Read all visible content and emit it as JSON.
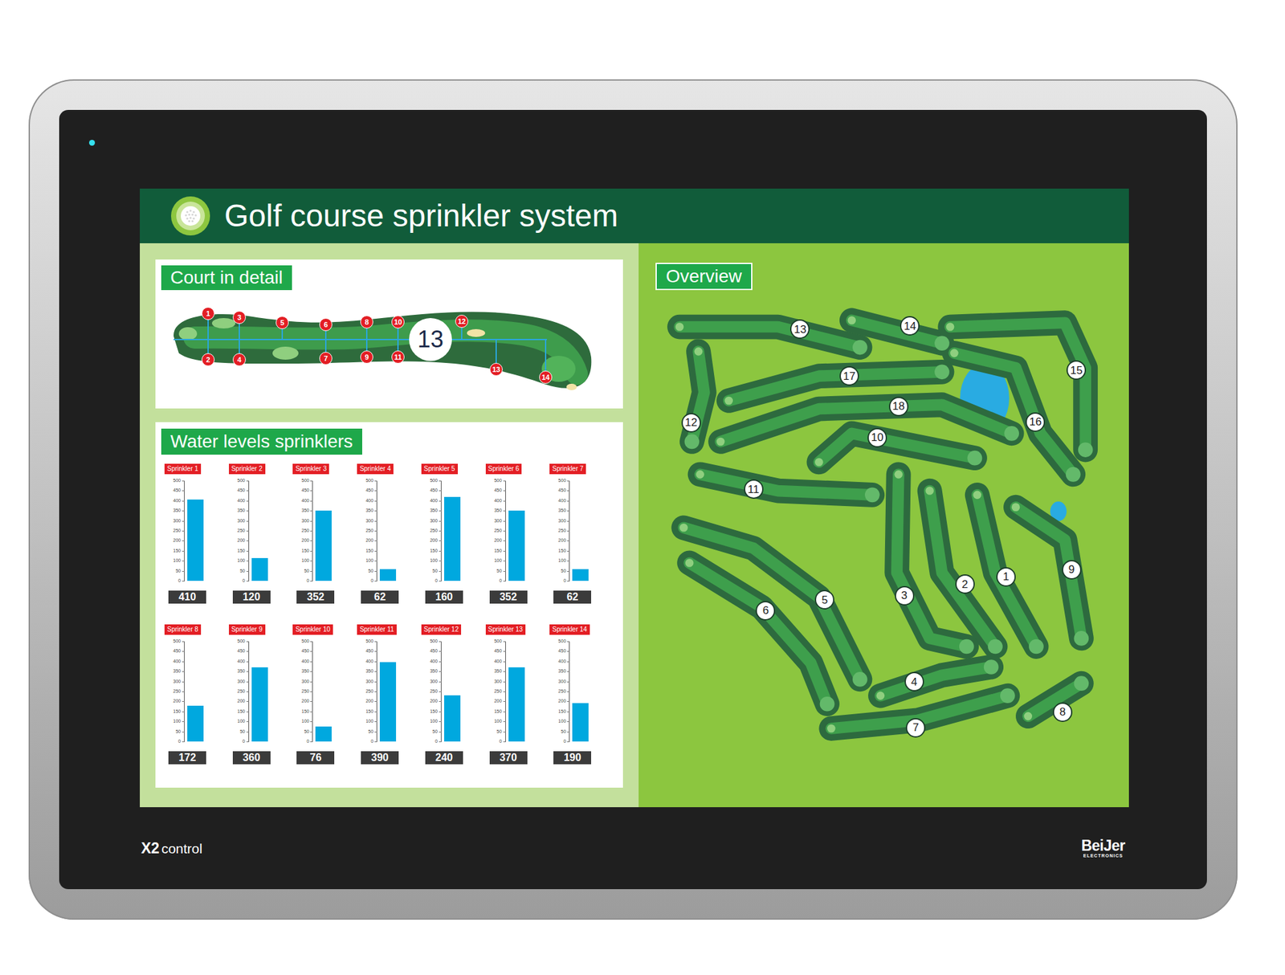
{
  "device": {
    "model": "X2",
    "model_suffix": "control",
    "brand": "BeiJer",
    "brand_sub": "ELECTRONICS",
    "power_on": true
  },
  "header": {
    "title": "Golf course sprinkler system"
  },
  "court_detail": {
    "title": "Court in detail",
    "hole": "13",
    "sprinklers": [
      "1",
      "2",
      "3",
      "4",
      "5",
      "6",
      "7",
      "8",
      "9",
      "10",
      "11",
      "12",
      "13",
      "14"
    ]
  },
  "water_levels": {
    "title": "Water levels sprinklers",
    "ticks": [
      "0",
      "50",
      "100",
      "150",
      "200",
      "250",
      "300",
      "350",
      "400",
      "450",
      "500"
    ],
    "sprinklers": [
      {
        "label": "Sprinkler 1",
        "value": 405,
        "reading": "410"
      },
      {
        "label": "Sprinkler 2",
        "value": 115,
        "reading": "120"
      },
      {
        "label": "Sprinkler 3",
        "value": 350,
        "reading": "352"
      },
      {
        "label": "Sprinkler 4",
        "value": 60,
        "reading": "62"
      },
      {
        "label": "Sprinkler 5",
        "value": 420,
        "reading": "160"
      },
      {
        "label": "Sprinkler 6",
        "value": 350,
        "reading": "352"
      },
      {
        "label": "Sprinkler 7",
        "value": 60,
        "reading": "62"
      },
      {
        "label": "Sprinkler 8",
        "value": 180,
        "reading": "172"
      },
      {
        "label": "Sprinkler 9",
        "value": 370,
        "reading": "360"
      },
      {
        "label": "Sprinkler 10",
        "value": 75,
        "reading": "76"
      },
      {
        "label": "Sprinkler 11",
        "value": 395,
        "reading": "390"
      },
      {
        "label": "Sprinkler 12",
        "value": 230,
        "reading": "240"
      },
      {
        "label": "Sprinkler 13",
        "value": 370,
        "reading": "370"
      },
      {
        "label": "Sprinkler 14",
        "value": 190,
        "reading": "190"
      }
    ]
  },
  "overview": {
    "title": "Overview",
    "holes": [
      "1",
      "2",
      "3",
      "4",
      "5",
      "6",
      "7",
      "8",
      "9",
      "10",
      "11",
      "12",
      "13",
      "14",
      "15",
      "16",
      "17",
      "18"
    ]
  }
}
